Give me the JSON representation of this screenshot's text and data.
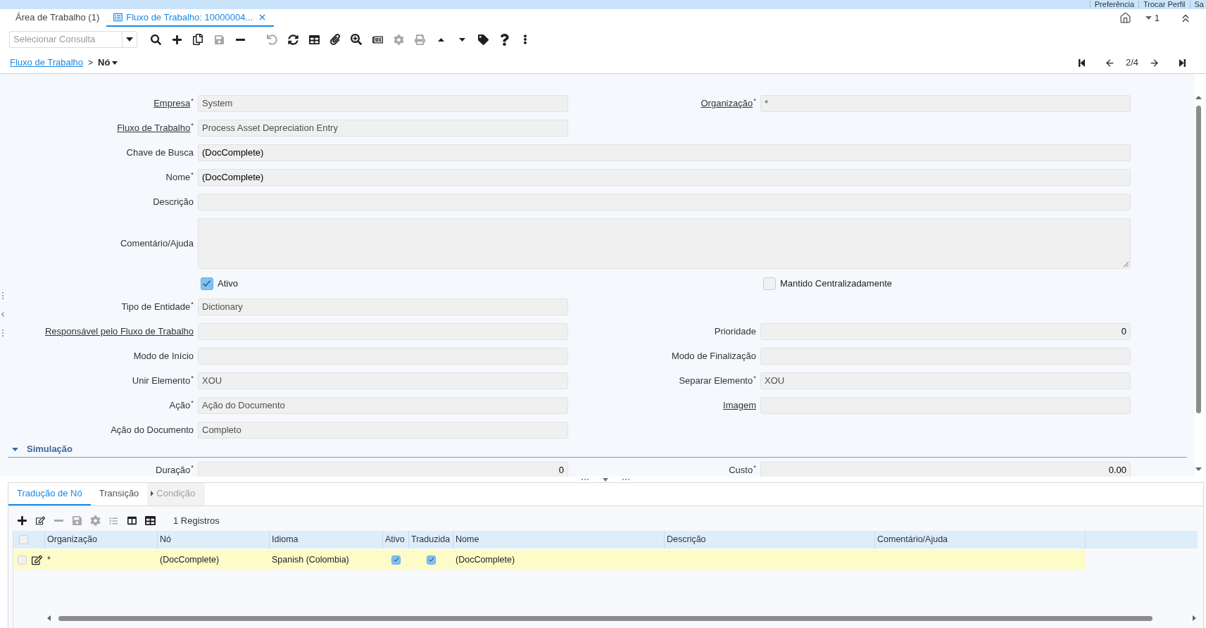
{
  "top_links": [
    "Preferência",
    "Trocar Perfil",
    "Sa"
  ],
  "window_tabs": [
    {
      "label": "Área de Trabalho (1)",
      "kind": "desktop",
      "selected": false
    },
    {
      "label": "Fluxo de Trabalho: 10000004...",
      "kind": "window",
      "selected": true
    }
  ],
  "tab_bar_tools": {
    "counter": "1"
  },
  "toolbar": {
    "query": {
      "placeholder": "Selecionar Consulta"
    },
    "groups": [
      [
        {
          "kind": "search",
          "disabled": false
        },
        {
          "kind": "new",
          "disabled": false
        },
        {
          "kind": "copy",
          "disabled": false
        },
        {
          "kind": "save",
          "disabled": true
        },
        {
          "kind": "delete",
          "disabled": false
        }
      ],
      [
        {
          "kind": "undo",
          "disabled": true
        },
        {
          "kind": "refresh",
          "disabled": false
        },
        {
          "kind": "grid",
          "disabled": false
        },
        {
          "kind": "attach",
          "disabled": false
        },
        {
          "kind": "zoom",
          "disabled": false
        },
        {
          "kind": "report",
          "disabled": false
        },
        {
          "kind": "process",
          "disabled": true
        },
        {
          "kind": "print",
          "disabled": true
        },
        {
          "kind": "up",
          "disabled": false
        },
        {
          "kind": "down",
          "disabled": false
        },
        {
          "kind": "tag",
          "disabled": false
        },
        {
          "kind": "help",
          "disabled": false
        },
        {
          "kind": "more",
          "disabled": false
        }
      ]
    ]
  },
  "breadcrumb": {
    "parent": "Fluxo de Trabalho",
    "separator": ">",
    "current": "Nó"
  },
  "record_nav": {
    "position": "2/4"
  },
  "form": {
    "rows": [
      {
        "kind": "pair",
        "left": {
          "label": "Empresa",
          "link": true,
          "mark": "*",
          "value": "System",
          "readonly": true
        },
        "right": {
          "label": "Organização",
          "link": true,
          "mark": "*",
          "value": "*",
          "readonly": true
        }
      },
      {
        "kind": "pair",
        "left": {
          "label": "Fluxo de Trabalho",
          "link": true,
          "mark": "*",
          "value": "Process Asset Depreciation Entry",
          "readonly": true
        }
      },
      {
        "kind": "wide",
        "field": {
          "label": "Chave de Busca",
          "link": false,
          "value": "(DocComplete)",
          "readonly": false
        }
      },
      {
        "kind": "wide",
        "field": {
          "label": "Nome",
          "link": false,
          "mark": "*",
          "value": "(DocComplete)",
          "readonly": false
        }
      },
      {
        "kind": "wide",
        "field": {
          "label": "Descrição",
          "link": false
        }
      },
      {
        "kind": "textarea",
        "field": {
          "label": "Comentário/Ajuda",
          "link": false
        }
      },
      {
        "kind": "checks",
        "left": {
          "label": "Ativo",
          "checked": true
        },
        "right": {
          "label": "Mantido Centralizadamente",
          "checked": false
        }
      },
      {
        "kind": "pair",
        "left": {
          "label": "Tipo de Entidade",
          "link": false,
          "mark": "*",
          "value": "Dictionary",
          "readonly": true
        }
      },
      {
        "kind": "pair",
        "left": {
          "label": "Responsável pelo Fluxo de Trabalho",
          "link": true
        },
        "right": {
          "label": "Prioridade",
          "link": false,
          "value": "0",
          "numeric": true,
          "readonly": false
        }
      },
      {
        "kind": "pair",
        "left": {
          "label": "Modo de Início",
          "link": false
        },
        "right": {
          "label": "Modo de Finalização",
          "link": false
        }
      },
      {
        "kind": "pair",
        "left": {
          "label": "Unir Elemento",
          "link": false,
          "mark": "*",
          "value": "XOU",
          "readonly": true
        },
        "right": {
          "label": "Separar Elemento",
          "link": false,
          "mark": "*",
          "value": "XOU",
          "readonly": true
        }
      },
      {
        "kind": "pair",
        "left": {
          "label": "Ação",
          "link": false,
          "mark": "*",
          "value": "Ação do Documento",
          "readonly": true
        },
        "right": {
          "label": "Imagem",
          "link": true
        }
      },
      {
        "kind": "pair",
        "left": {
          "label": "Ação do Documento",
          "link": false,
          "value": "Completo",
          "readonly": true
        }
      }
    ],
    "section": {
      "title": "Simulação",
      "expanded": true,
      "rows": [
        {
          "kind": "pair",
          "left": {
            "label": "Duração",
            "link": false,
            "mark": "*",
            "value": "0",
            "numeric": true,
            "readonly": false
          },
          "right": {
            "label": "Custo",
            "link": false,
            "mark": "*",
            "value": "0.00",
            "numeric": true,
            "readonly": false
          }
        }
      ]
    }
  },
  "detail": {
    "tabs": [
      {
        "label": "Tradução de Nó",
        "kind": "plain",
        "selected": true,
        "disabled": false
      },
      {
        "label": "Transição",
        "kind": "plain",
        "selected": false,
        "disabled": false
      },
      {
        "label": "Condição",
        "kind": "toggle",
        "selected": false,
        "disabled": true
      }
    ],
    "toolbar": [
      {
        "kind": "new",
        "disabled": false
      },
      {
        "kind": "edit",
        "disabled": false
      },
      {
        "kind": "delete",
        "disabled": true
      },
      {
        "kind": "save",
        "disabled": true
      },
      {
        "kind": "process",
        "disabled": true
      },
      {
        "kind": "checklist",
        "disabled": true
      },
      {
        "kind": "columns",
        "disabled": false
      },
      {
        "kind": "grid",
        "disabled": false
      }
    ],
    "record_count": "1 Registros",
    "table": {
      "select_all": false,
      "columns": [
        "Organização",
        "Nó",
        "Idioma",
        "Ativo",
        "Traduzida",
        "Nome",
        "Descrição",
        "Comentário/Ajuda"
      ],
      "rows": [
        {
          "checked": false,
          "current": true,
          "cells": [
            {
              "kind": "text",
              "value": "*"
            },
            {
              "kind": "text",
              "value": "(DocComplete)"
            },
            {
              "kind": "text",
              "value": "Spanish (Colombia)"
            },
            {
              "kind": "check",
              "checked": true
            },
            {
              "kind": "check",
              "checked": true
            },
            {
              "kind": "text",
              "value": "(DocComplete)"
            },
            {
              "kind": "empty"
            },
            {
              "kind": "empty"
            }
          ]
        }
      ]
    }
  }
}
